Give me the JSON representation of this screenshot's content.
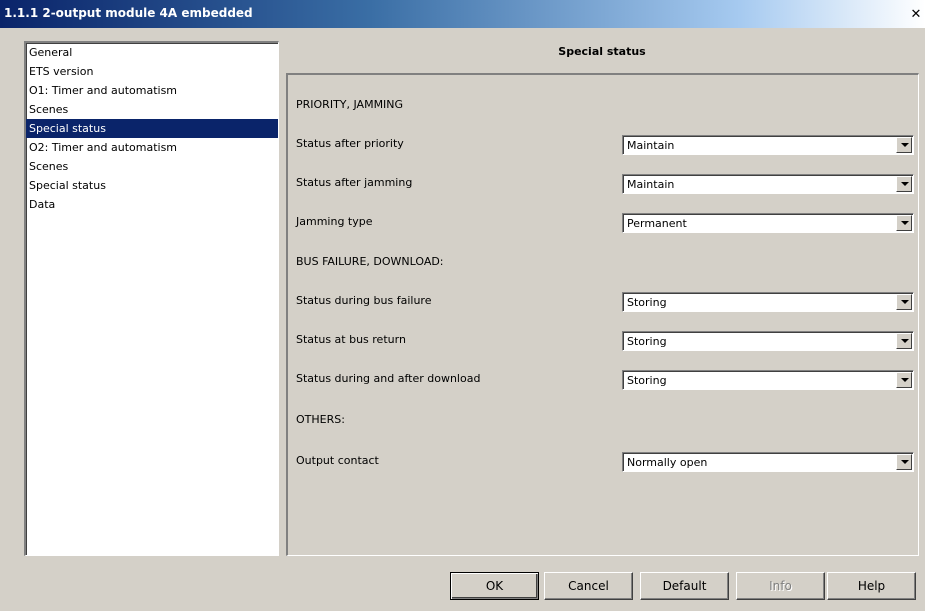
{
  "window": {
    "title": "1.1.1 2-output module 4A embedded",
    "close_glyph": "✕"
  },
  "nav": {
    "items": [
      {
        "label": "General",
        "selected": false
      },
      {
        "label": "ETS version",
        "selected": false
      },
      {
        "label": "O1: Timer and automatism",
        "selected": false
      },
      {
        "label": "Scenes",
        "selected": false
      },
      {
        "label": "Special status",
        "selected": true
      },
      {
        "label": "O2: Timer and automatism",
        "selected": false
      },
      {
        "label": "Scenes",
        "selected": false
      },
      {
        "label": "Special status",
        "selected": false
      },
      {
        "label": "Data",
        "selected": false
      }
    ]
  },
  "panel": {
    "title": "Special status",
    "sections": {
      "priority": "PRIORITY, JAMMING",
      "bus": "BUS FAILURE, DOWNLOAD:",
      "others": "OTHERS:"
    },
    "params": [
      {
        "label": "Status after priority",
        "value": "Maintain"
      },
      {
        "label": "Status after jamming",
        "value": "Maintain"
      },
      {
        "label": "Jamming type",
        "value": "Permanent"
      },
      {
        "label": "Status during bus failure",
        "value": "Storing"
      },
      {
        "label": "Status at bus return",
        "value": "Storing"
      },
      {
        "label": "Status during and after download",
        "value": "Storing"
      },
      {
        "label": "Output contact",
        "value": "Normally open"
      }
    ]
  },
  "buttons": {
    "ok": "OK",
    "cancel": "Cancel",
    "default": "Default",
    "info": "Info",
    "help": "Help"
  },
  "colors": {
    "selection": "#0a246a",
    "face": "#d4d0c8"
  }
}
